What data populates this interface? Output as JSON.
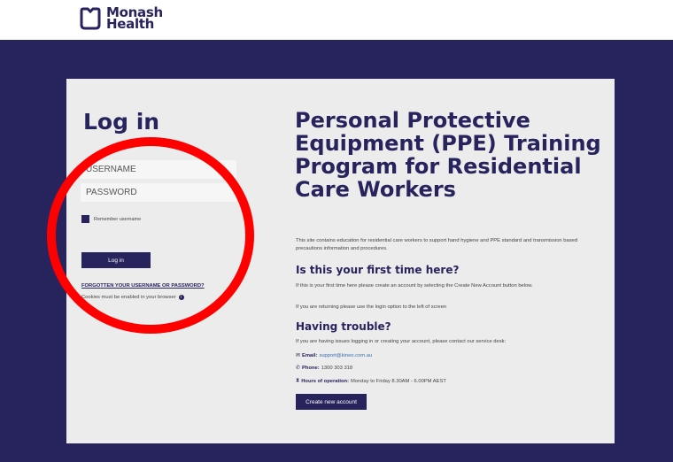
{
  "brand": {
    "line1": "Monash",
    "line2": "Health"
  },
  "login": {
    "title": "Log in",
    "username_placeholder": "USERNAME",
    "password_placeholder": "PASSWORD",
    "remember_label": "Remember username",
    "login_button": "Log in",
    "forgot_link": "FORGOTTEN YOUR USERNAME OR PASSWORD?",
    "cookies_note": "Cookies must be enabled in your browser"
  },
  "info": {
    "title": "Personal Protective Equipment (PPE) Training Program for Residential Care Workers",
    "intro": "This site contains education for residential care workers to support hand hygiene and PPE standard and transmission based precautions information and procedures.",
    "first_time_heading": "Is this your first time here?",
    "first_time_p1": "If this is your first time here please create an account by selecting the Create New Account button below.",
    "first_time_p2": "If you are returning please use the login option to the left of screen",
    "trouble_heading": "Having trouble?",
    "trouble_p": "If you are having issues logging in or creating your account, please contact our service desk:",
    "email_label": "Email:",
    "email_value": "support@kineo.com.au",
    "phone_label": "Phone:",
    "phone_value": "1300 303 318",
    "hours_label": "Hours of operation:",
    "hours_value": "Monday to Friday 8.30AM - 6.00PM AEST",
    "create_button": "Create new account"
  },
  "colors": {
    "brand": "#27235c",
    "annotation": "#ff0000",
    "card": "#ececec"
  },
  "icons": [
    "monash-logo-icon",
    "info-icon",
    "email-icon",
    "phone-icon",
    "clock-icon"
  ]
}
